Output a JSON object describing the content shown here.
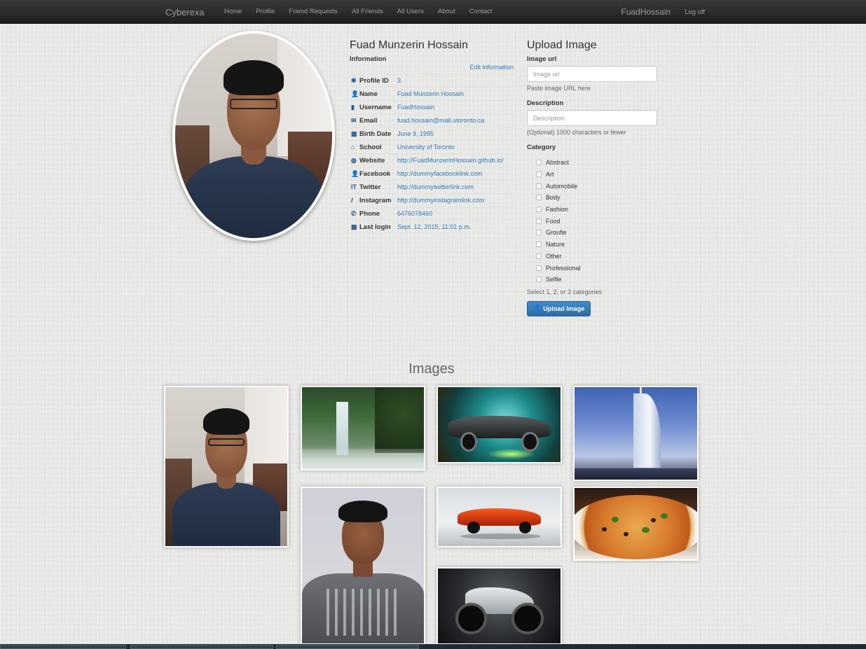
{
  "navbar": {
    "brand": "Cyberexa",
    "links": [
      "Home",
      "Profile",
      "Friend Requests",
      "All Friends",
      "All Users",
      "About",
      "Contact"
    ],
    "user": "FuadHossain",
    "logoff": "Log off"
  },
  "profile": {
    "name": "Fuad Munzerin Hossain",
    "section_label": "Information",
    "edit_link": "Edit information",
    "fields": [
      {
        "icon": "asterisk-icon",
        "label": "Profile ID",
        "value": "3"
      },
      {
        "icon": "user-icon",
        "label": "Name",
        "value": "Fuad Munzerin Hossain"
      },
      {
        "icon": "bookmark-icon",
        "label": "Username",
        "value": "FuadHossain"
      },
      {
        "icon": "envelope-icon",
        "label": "Email",
        "value": "fuad.hossain@mail.utoronto.ca"
      },
      {
        "icon": "calendar-icon",
        "label": "Birth Date",
        "value": "June 9, 1995"
      },
      {
        "icon": "school-icon",
        "label": "School",
        "value": "University of Toronto"
      },
      {
        "icon": "globe-icon",
        "label": "Website",
        "value": "http://FuadMunzerinHossain.github.io/"
      },
      {
        "icon": "user-icon",
        "label": "Facebook",
        "value": "http://dummyfacebooklink.com"
      },
      {
        "icon": "text-icon",
        "label": "Twitter",
        "value": "http://dummytwitterlink.com"
      },
      {
        "icon": "italic-icon",
        "label": "Instagram",
        "value": "http://dummyinstagramlink.com"
      },
      {
        "icon": "phone-icon",
        "label": "Phone",
        "value": "6476078460"
      },
      {
        "icon": "calendar-icon",
        "label": "Last login",
        "value": "Sept. 12, 2015, 11:01 p.m."
      }
    ]
  },
  "upload": {
    "title": "Upload Image",
    "url_label": "Image url",
    "url_placeholder": "Image url",
    "url_help": "Paste image URL here",
    "desc_label": "Description",
    "desc_placeholder": "Description",
    "desc_help": "(Optional) 1000 characters or fewer",
    "category_label": "Category",
    "categories": [
      "Abstract",
      "Art",
      "Automobile",
      "Body",
      "Fashion",
      "Food",
      "Groufie",
      "Nature",
      "Other",
      "Professional",
      "Selfie"
    ],
    "category_help": "Select 1, 2, or 3 categories",
    "button_label": "Upload Image"
  },
  "gallery": {
    "title": "Images"
  },
  "colors": {
    "link": "#337ab7",
    "navbar": "#222222",
    "primary_button": "#428bca",
    "icon": "#2a5c8f"
  }
}
